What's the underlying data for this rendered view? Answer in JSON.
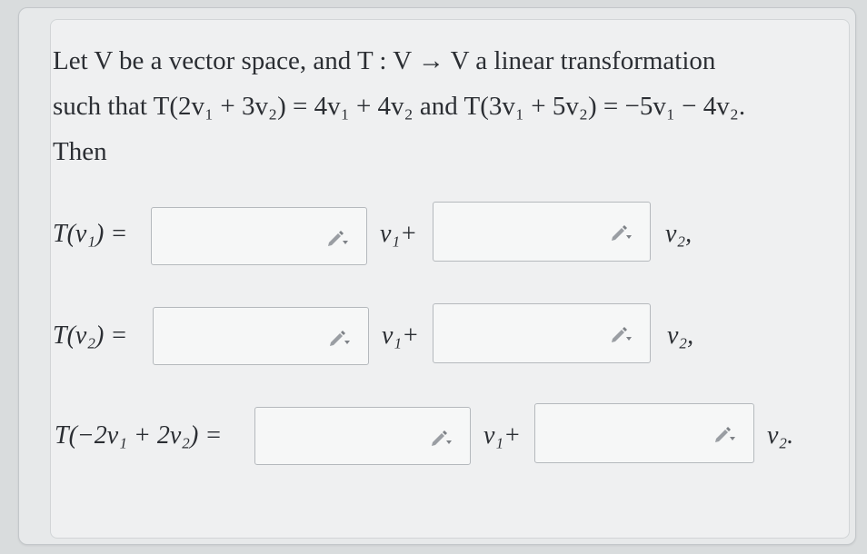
{
  "problem": {
    "line1": "Let V be a vector space, and T : V → V a linear transformation",
    "line2": "such that T(2v₁ + 3v₂) = 4v₁ + 4v₂ and T(3v₁ + 5v₂) = −5v₁ − 4v₂.",
    "line3": "Then"
  },
  "rows": [
    {
      "lhs": "T(v₁) =",
      "v1_label": "v₁+",
      "v2_label": "v₂,",
      "input1_value": "",
      "input2_value": ""
    },
    {
      "lhs": "T(v₂) =",
      "v1_label": "v₁+",
      "v2_label": "v₂,",
      "input1_value": "",
      "input2_value": ""
    },
    {
      "lhs": "T(−2v₁ + 2v₂) =",
      "v1_label": "v₁+",
      "v2_label": "v₂.",
      "input1_value": "",
      "input2_value": ""
    }
  ],
  "icons": {
    "pencil": "pencil-icon"
  }
}
